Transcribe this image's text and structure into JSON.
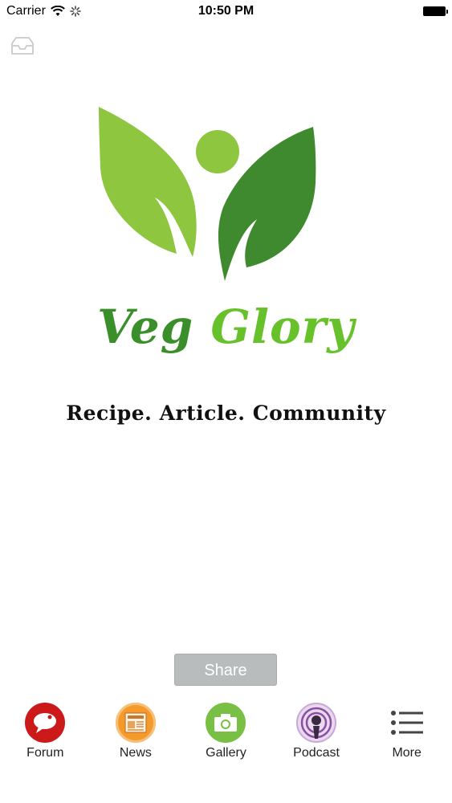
{
  "status_bar": {
    "carrier": "Carrier",
    "time": "10:50 PM"
  },
  "brand": {
    "title_word_1": "Veg",
    "title_word_2": "Glory",
    "tagline": "Recipe. Article. Community"
  },
  "share": {
    "label": "Share"
  },
  "tabs": [
    {
      "label": "Forum",
      "icon": "forum-icon",
      "color": "#cc1a1a"
    },
    {
      "label": "News",
      "icon": "news-icon",
      "color": "#f39a2a"
    },
    {
      "label": "Gallery",
      "icon": "gallery-icon",
      "color": "#77c043"
    },
    {
      "label": "Podcast",
      "icon": "podcast-icon",
      "color": "#8a4fa3"
    },
    {
      "label": "More",
      "icon": "more-icon",
      "color": "#555555"
    }
  ],
  "colors": {
    "leaf_light": "#8ec63f",
    "leaf_dark": "#3f8a2e",
    "share_bg": "#b9bcbc"
  }
}
